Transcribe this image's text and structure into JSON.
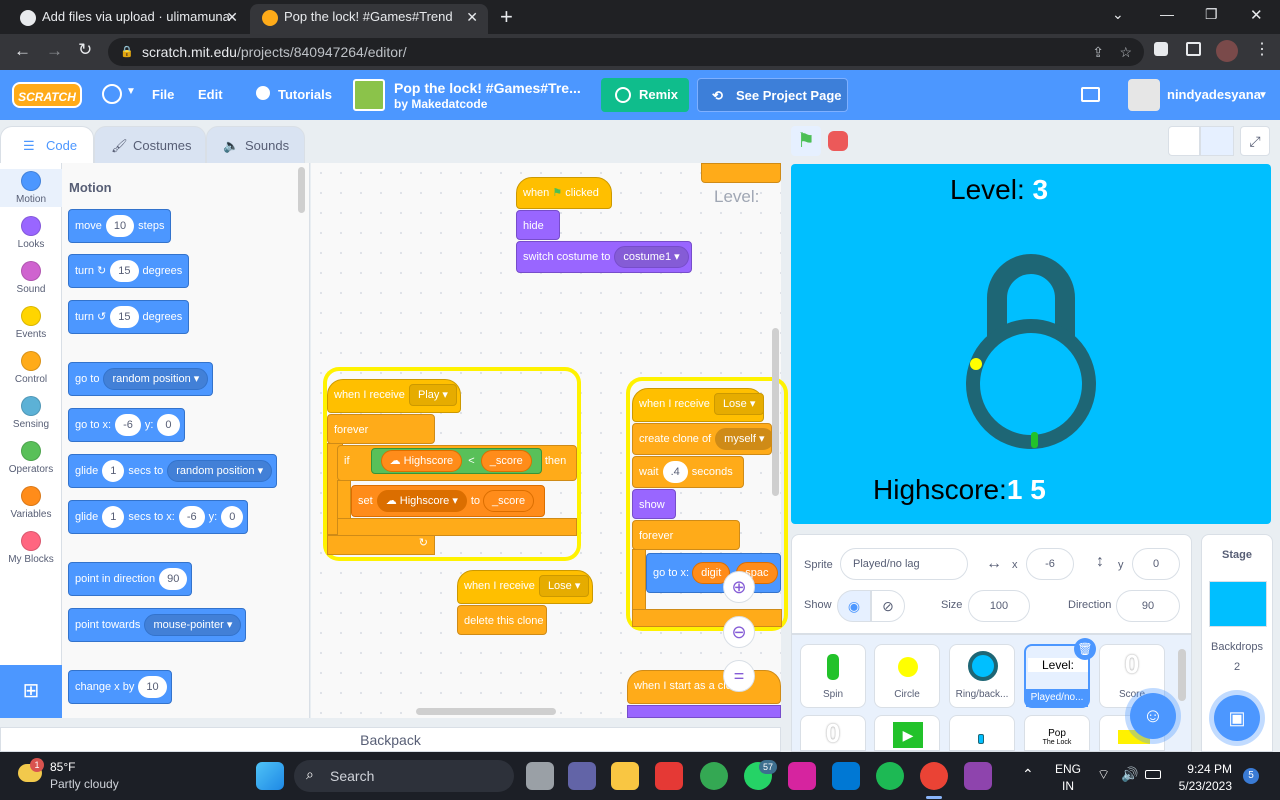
{
  "browser": {
    "tabs": [
      {
        "title": "Add files via upload · ulimamuna",
        "close": "✕"
      },
      {
        "title": "Pop the lock! #Games#Trend",
        "close": "✕"
      }
    ],
    "new_tab": "+",
    "url_domain": "scratch.mit.edu",
    "url_path": "/projects/840947264/editor/"
  },
  "menu": {
    "logo": "SCRATCH",
    "file": "File",
    "edit": "Edit",
    "tutorials": "Tutorials",
    "project_title": "Pop the lock! #Games#Tre...",
    "author": "by Makedatcode",
    "remix": "Remix",
    "see_project": "See Project Page",
    "username": "nindyadesyana"
  },
  "editor_tabs": {
    "code": "Code",
    "costumes": "Costumes",
    "sounds": "Sounds"
  },
  "categories": [
    {
      "name": "Motion",
      "color": "#4c97ff"
    },
    {
      "name": "Looks",
      "color": "#9966ff"
    },
    {
      "name": "Sound",
      "color": "#cf63cf"
    },
    {
      "name": "Events",
      "color": "#ffd500"
    },
    {
      "name": "Control",
      "color": "#ffab19"
    },
    {
      "name": "Sensing",
      "color": "#5cb1d6"
    },
    {
      "name": "Operators",
      "color": "#59c059"
    },
    {
      "name": "Variables",
      "color": "#ff8c1a"
    },
    {
      "name": "My Blocks",
      "color": "#ff6680"
    }
  ],
  "palette": {
    "heading": "Motion",
    "move": {
      "a": "move",
      "v": "10",
      "b": "steps"
    },
    "turn_right": {
      "a": "turn",
      "v": "15",
      "b": "degrees"
    },
    "turn_left": {
      "a": "turn",
      "v": "15",
      "b": "degrees"
    },
    "goto": {
      "a": "go to",
      "dd": "random position"
    },
    "gotoxy": {
      "a": "go to x:",
      "x": "-6",
      "b": "y:",
      "y": "0"
    },
    "glide": {
      "a": "glide",
      "v": "1",
      "b": "secs to",
      "dd": "random position"
    },
    "glidexy": {
      "a": "glide",
      "v": "1",
      "b": "secs to x:",
      "x": "-6",
      "c": "y:",
      "y": "0"
    },
    "point_dir": {
      "a": "point in direction",
      "v": "90"
    },
    "point_towards": {
      "a": "point towards",
      "dd": "mouse-pointer"
    },
    "change_x": {
      "a": "change x by",
      "v": "10"
    }
  },
  "scripts": {
    "flag": {
      "when": "when",
      "clicked": "clicked",
      "hide": "hide",
      "switch": "switch costume to",
      "costume": "costume1"
    },
    "level_label": "Level:",
    "play": {
      "when": "when I receive",
      "msg": "Play",
      "forever": "forever",
      "if": "if",
      "var": "Highscore",
      "lt": "<",
      "score": "_score",
      "then": "then",
      "set": "set",
      "to": "to"
    },
    "lose1": {
      "when": "when I receive",
      "msg": "Lose",
      "delete": "delete this clone"
    },
    "lose2": {
      "when": "when I receive",
      "msg": "Lose",
      "create": "create clone of",
      "myself": "myself",
      "wait": "wait",
      "secs": ".4",
      "seconds": "seconds",
      "show": "show",
      "forever": "forever",
      "goto": "go to x:",
      "digit": "digit",
      "space": "spac"
    },
    "clone": "when I start as a clone"
  },
  "stage": {
    "level_label": "Level:",
    "level_value": "3",
    "highscore_label": "Highscore:",
    "highscore_value": "1 5"
  },
  "sprite_info": {
    "sprite_label": "Sprite",
    "sprite_name": "Played/no lag",
    "x_label": "x",
    "x": "-6",
    "y_label": "y",
    "y": "0",
    "show_label": "Show",
    "size_label": "Size",
    "size": "100",
    "direction_label": "Direction",
    "direction": "90"
  },
  "sprites": [
    {
      "name": "Spin"
    },
    {
      "name": "Circle"
    },
    {
      "name": "Ring/back..."
    },
    {
      "name": "Played/no...",
      "thumb": "Level:"
    },
    {
      "name": "Score",
      "thumb": "0"
    }
  ],
  "sprites_row2": [
    {
      "thumb": "0"
    },
    {
      "thumb": ""
    },
    {
      "thumb": ""
    },
    {
      "thumb": "Pop",
      "thumb2": "The Lock"
    },
    {
      "thumb": ""
    }
  ],
  "stage_panel": {
    "title": "Stage",
    "backdrops_label": "Backdrops",
    "backdrops": "2"
  },
  "backpack": "Backpack",
  "taskbar": {
    "weather_temp": "85°F",
    "weather_desc": "Partly cloudy",
    "weather_badge": "1",
    "search": "Search",
    "whatsapp_badge": "57",
    "lang1": "ENG",
    "lang2": "IN",
    "time": "9:24 PM",
    "date": "5/23/2023",
    "notif": "5"
  }
}
